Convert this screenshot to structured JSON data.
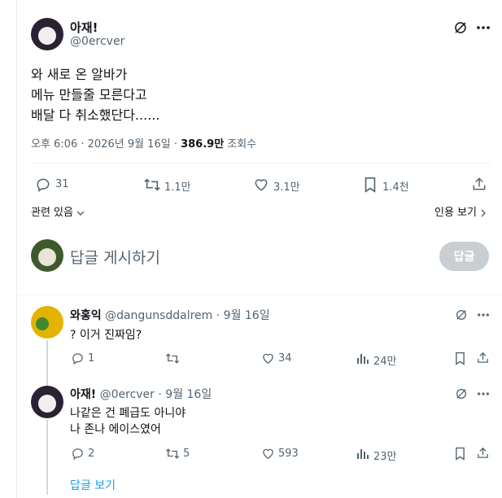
{
  "main_tweet": {
    "display_name": "아재!",
    "handle": "@0ercver",
    "lines": [
      "와 새로 온 알바가",
      "메뉴 만들줄 모른다고",
      "배달 다 취소했단다......"
    ],
    "time": "오후 6:06 · 2026년 9월 16일 ·",
    "views": "386.9만",
    "views_label": "조회수",
    "replies": "31",
    "retweets": "1.1만",
    "likes": "3.1만",
    "bookmarks": "1.4천"
  },
  "related": {
    "left": "관련 있음",
    "right": "인용 보기"
  },
  "compose": {
    "placeholder": "답글 게시하기",
    "button": "답글"
  },
  "replies": [
    {
      "display_name": "와홍익",
      "handle": "@dangunsddalrem",
      "date": "· 9월 16일",
      "lines": [
        "? 이거 진짜임?"
      ],
      "replies": "1",
      "retweets": "",
      "likes": "34",
      "views": "24만"
    },
    {
      "display_name": "아재!",
      "handle": "@0ercver",
      "date": "· 9월 16일",
      "lines": [
        "나같은 건 폐급도 아니야",
        "나 존나 에이스였어"
      ],
      "replies": "2",
      "retweets": "5",
      "likes": "593",
      "views": "23만"
    }
  ],
  "show_replies": "답글 보기",
  "icons": [
    "grok-icon",
    "more-icon",
    "reply-icon",
    "retweet-icon",
    "like-icon",
    "bookmark-icon",
    "share-icon",
    "views-icon",
    "chevron-down-icon",
    "chevron-right-icon"
  ],
  "colors": {
    "link": "#1d9bf0",
    "muted": "#536471",
    "button_disabled": "#c9ced2"
  }
}
